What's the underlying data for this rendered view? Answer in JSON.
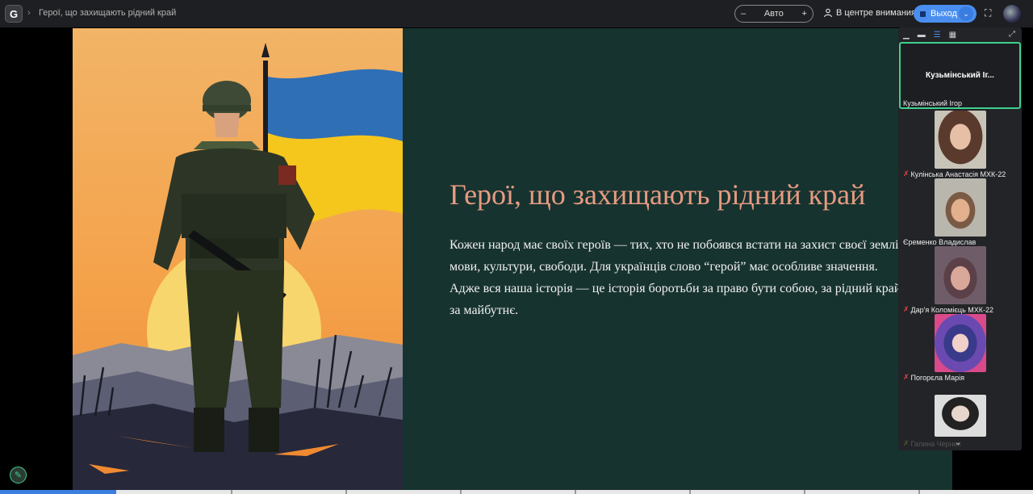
{
  "header": {
    "logo_letter": "G",
    "breadcrumb_sep": "›",
    "doc_title": "Герої, що захищають рідний край",
    "zoom": {
      "minus": "–",
      "value": "Авто",
      "plus": "+"
    },
    "spotlight_label": "В центре внимания",
    "exit_label": "Выход",
    "exit_dropdown": "⌄",
    "fullscreen_glyph": "⛶"
  },
  "slide": {
    "title": "Герої, що захищають рідний край",
    "body": "Кожен народ має своїх героїв — тих, хто не побоявся встати на захист своєї землі, мови, культури, свободи. Для українців слово “герой” має особливе значення. Адже вся наша історія — це історія боротьби за право бути собою, за рідний край, за майбутнє.",
    "colors": {
      "background": "#17332f",
      "title": "#e79b82",
      "body": "#f1f1f1"
    }
  },
  "participants": {
    "tools": {
      "min": "▁",
      "strip": "▬",
      "list": "☰",
      "grid": "▦",
      "expand": "⤢"
    },
    "main": {
      "big_name": "Кузьмінський Іг...",
      "caption": "Кузьмінський Ігор"
    },
    "list": [
      {
        "name": "Кулінська Анастасія МХК-22"
      },
      {
        "name": "Єременко Владислав"
      },
      {
        "name": "Дар'я Коломієць МХК-22"
      },
      {
        "name": "Погорєла Марія"
      },
      {
        "name": "Галина Черник"
      }
    ],
    "more": "⌄"
  },
  "accent_color": "#3ed08e",
  "brand_color": "#4a8ff0"
}
